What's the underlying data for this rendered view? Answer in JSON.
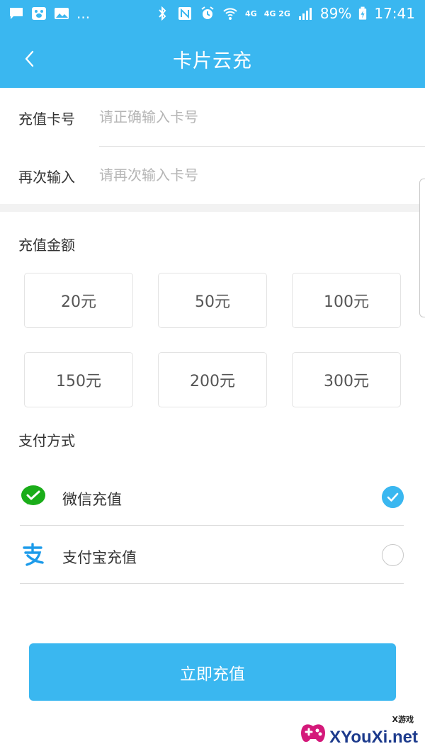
{
  "status_bar": {
    "more": "...",
    "net_4g": "4G",
    "net_4g_2g": "4G 2G",
    "battery": "89%",
    "time": "17:41"
  },
  "header": {
    "title": "卡片云充"
  },
  "card": {
    "number_label": "充值卡号",
    "number_placeholder": "请正确输入卡号",
    "confirm_label": "再次输入",
    "confirm_placeholder": "请再次输入卡号"
  },
  "amount": {
    "title": "充值金额",
    "options": [
      "20元",
      "50元",
      "100元",
      "150元",
      "200元",
      "300元"
    ]
  },
  "payment": {
    "title": "支付方式",
    "methods": [
      {
        "label": "微信充值",
        "icon": "wechat-pay-icon",
        "selected": true
      },
      {
        "label": "支付宝充值",
        "icon": "alipay-icon",
        "selected": false
      }
    ]
  },
  "submit": {
    "label": "立即充值"
  },
  "watermark": {
    "text": "XYouXi.net",
    "small": "X游戏"
  },
  "colors": {
    "accent": "#3ab7f0",
    "wechat": "#1aad19",
    "alipay": "#1d9bea"
  }
}
